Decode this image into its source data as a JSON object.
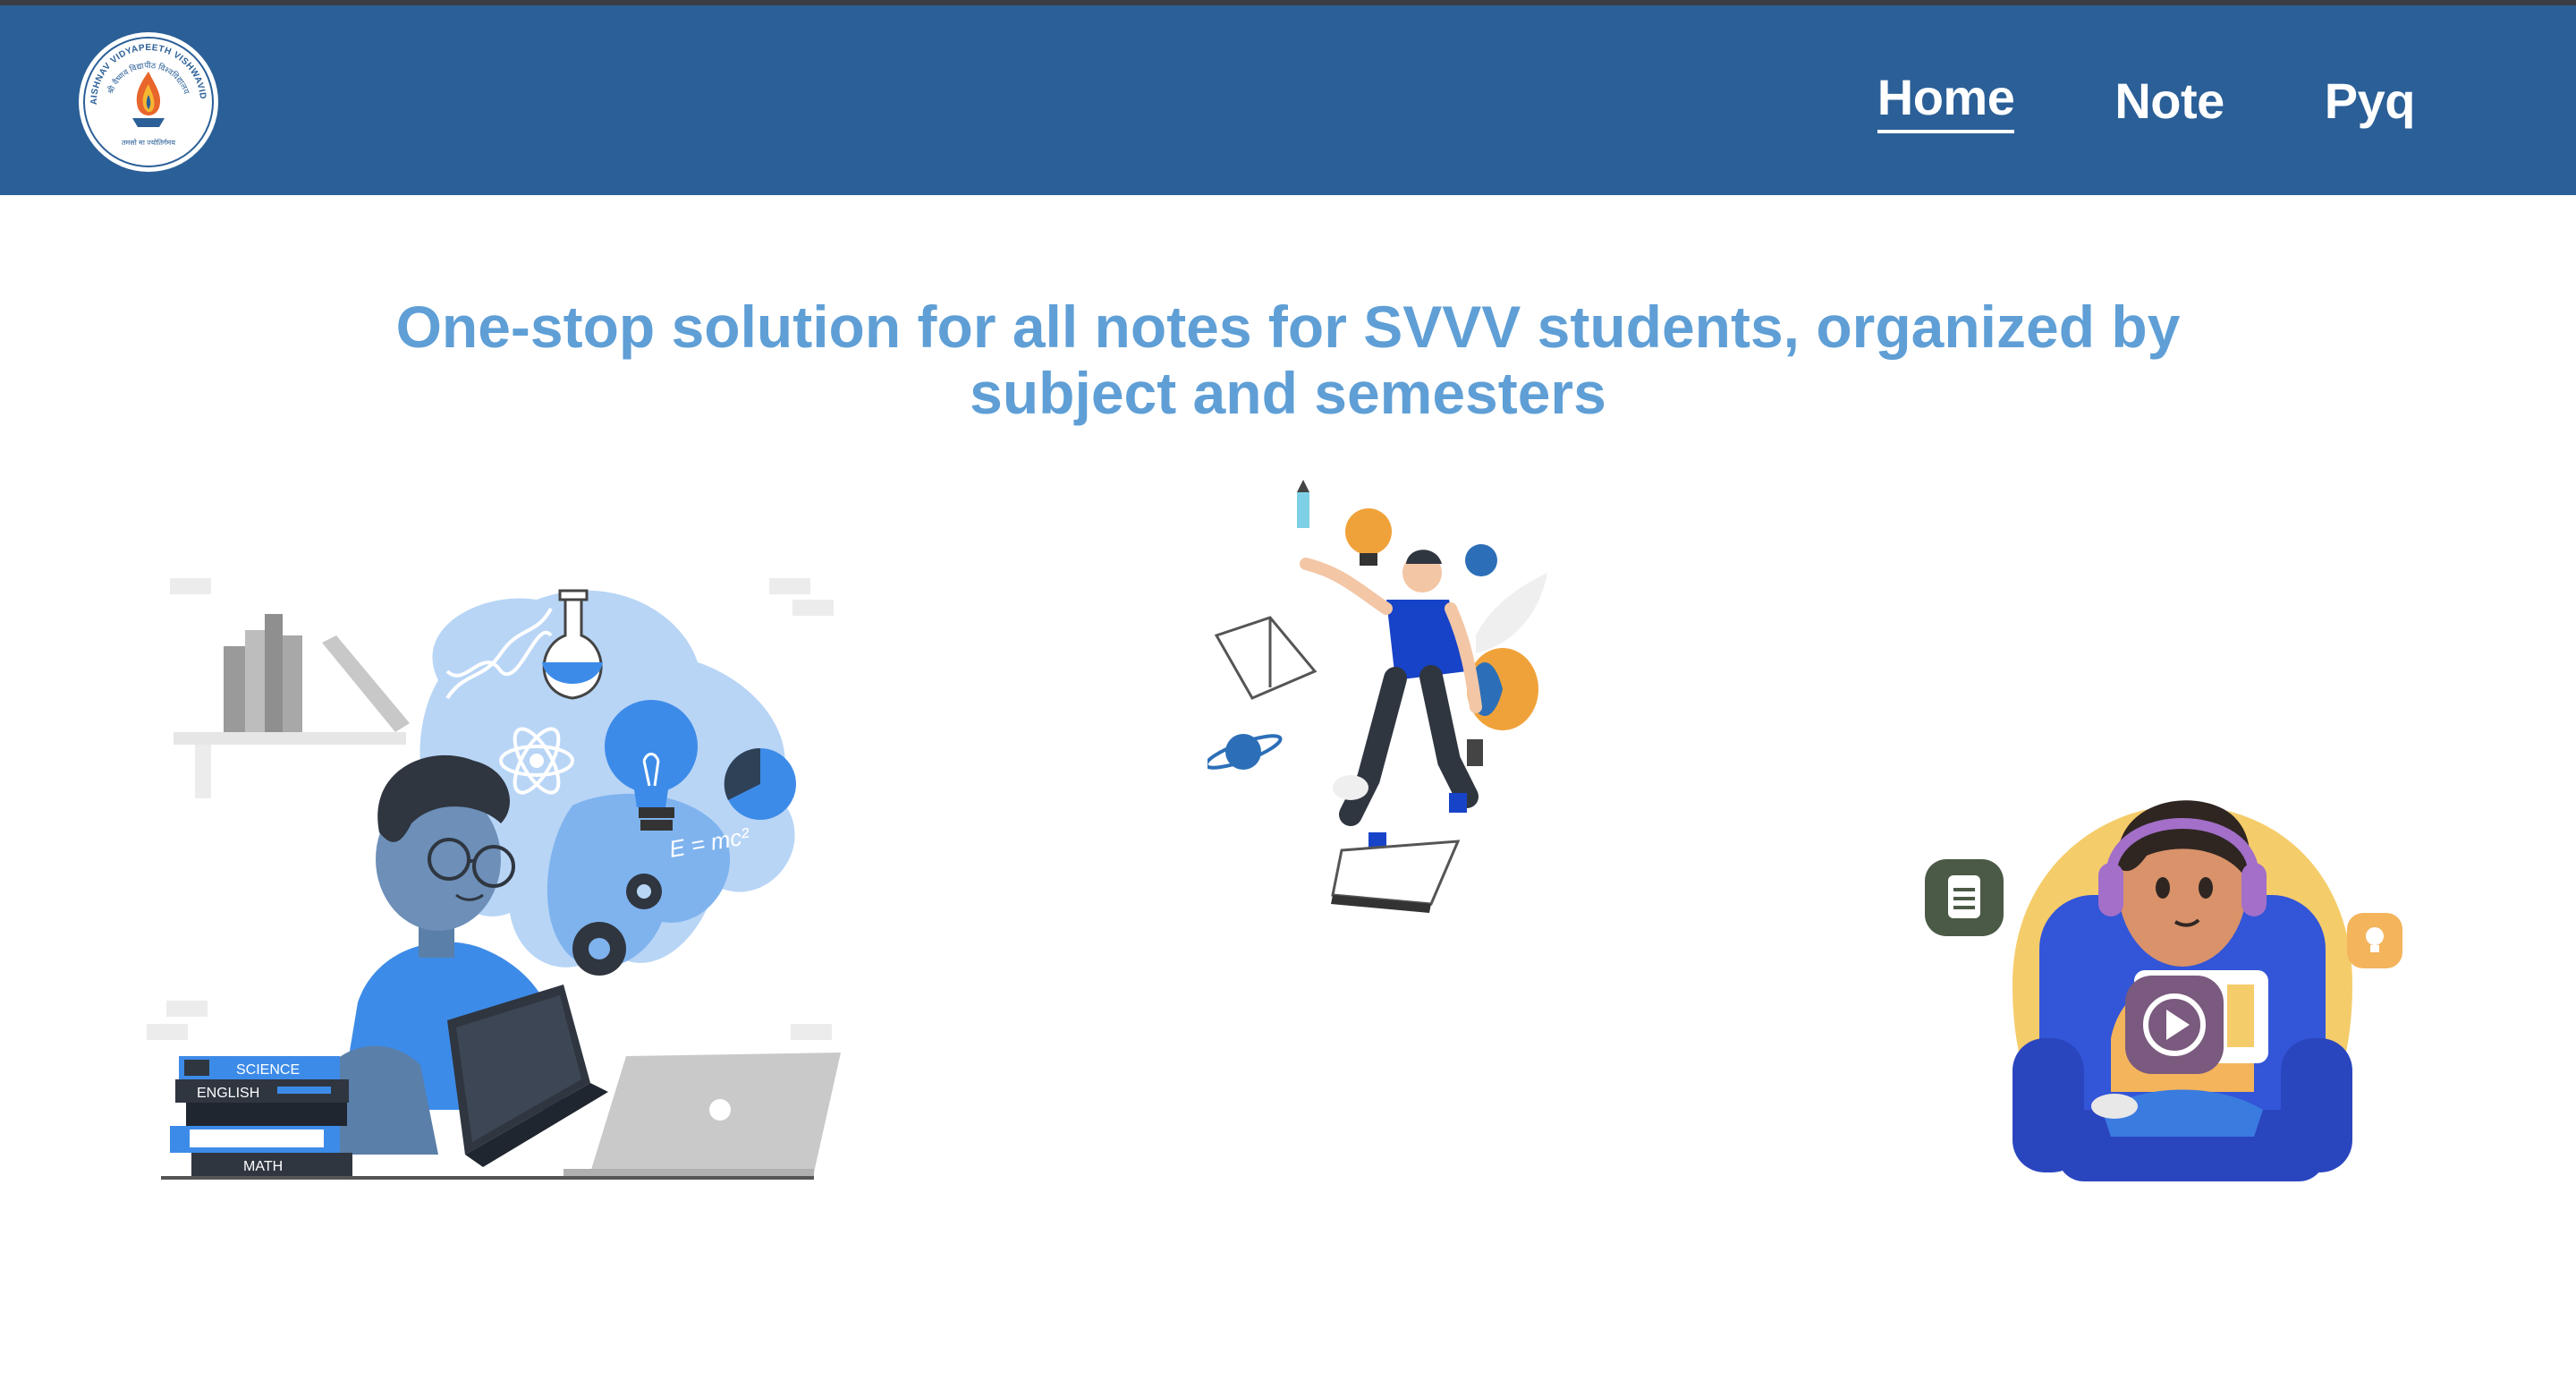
{
  "header": {
    "logo": {
      "arc_text": "SHRI VAISHNAV VIDYAPEETH VISHWAVIDYALAYA",
      "hindi_arc_text": "श्री वैष्णव विद्यापीठ विश्वविद्यालय",
      "motto": "तमसो मा ज्योतिर्गमय",
      "icon": "flame-emblem-icon"
    },
    "nav": [
      {
        "label": "Home",
        "active": true
      },
      {
        "label": "Note",
        "active": false
      },
      {
        "label": "Pyq",
        "active": false
      }
    ]
  },
  "hero": {
    "headline_line1": "One-stop solution for all notes for SVVV students, organized by",
    "headline_line2": "subject and semesters"
  },
  "illustrations": {
    "study": {
      "icon": "student-studying-illustration",
      "books": [
        "SCIENCE",
        "ENGLISH",
        "MATH"
      ],
      "formula": "E = mc²"
    },
    "idea": {
      "icon": "man-juggling-ideas-illustration"
    },
    "learn": {
      "icon": "kid-online-learning-illustration"
    }
  },
  "colors": {
    "navbar": "#2b5f97",
    "headline": "#5f9fd6",
    "accent_blue": "#3d8be8",
    "yellow": "#f5cc6a"
  }
}
